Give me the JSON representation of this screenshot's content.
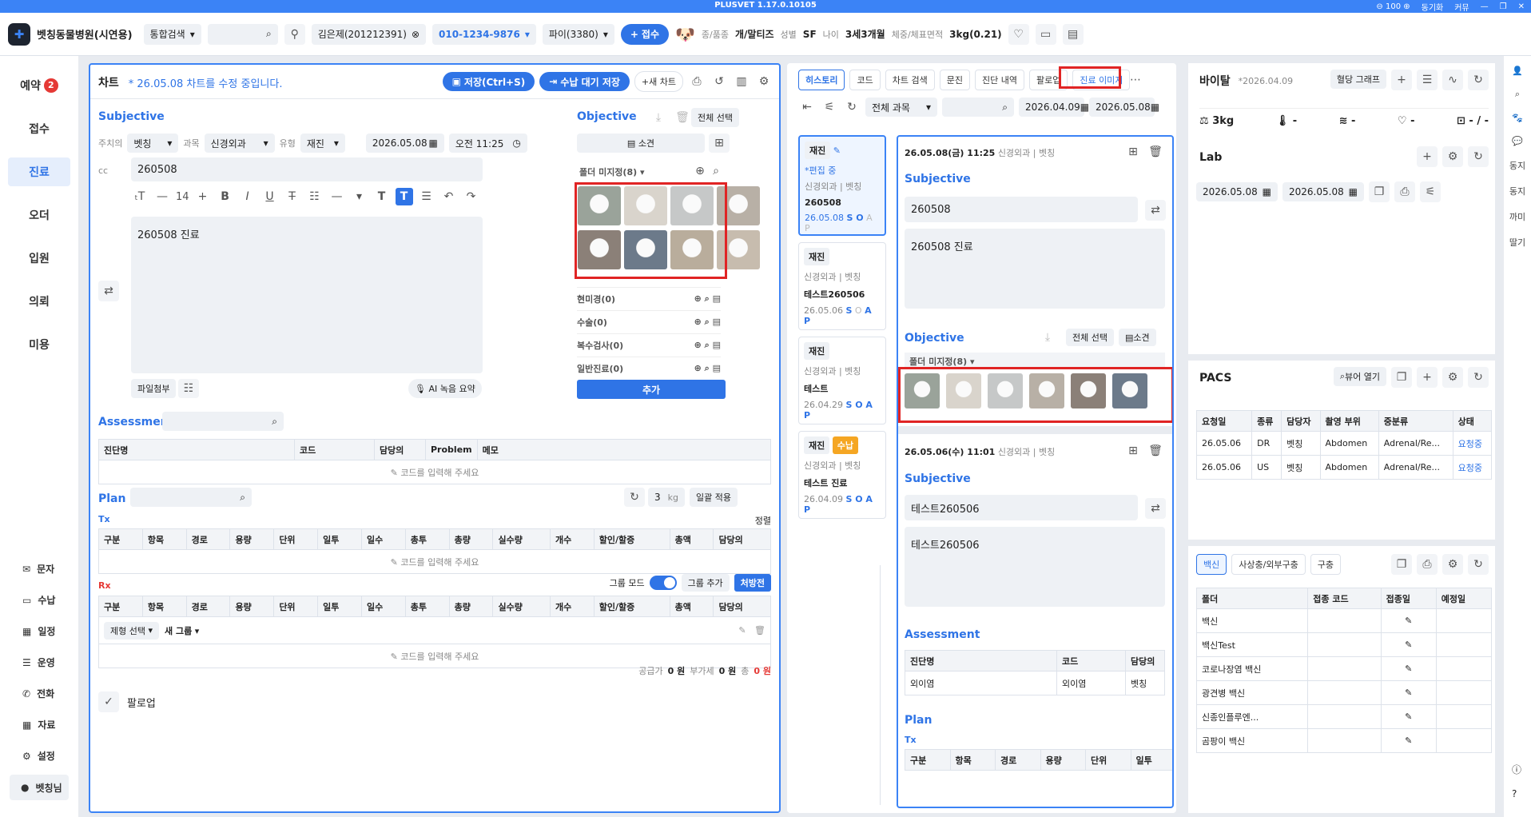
{
  "app": {
    "title": "PLUSVET 1.17.0.10105",
    "zoom": "100",
    "sync": "동기화",
    "mode": "커뮤",
    "phone": "커뮤"
  },
  "header": {
    "hospital": "벳칭동물병원(시연용)",
    "search_type": "통합검색",
    "patient": "김은제(201212391)",
    "phone": "010-1234-9876",
    "pet": "파이(3380)",
    "reception_btn": "접수",
    "species_label": "종/품종",
    "species": "개/말티즈",
    "sex_label": "성별",
    "sex": "SF",
    "age_label": "나이",
    "age": "3세3개월",
    "weight_label": "체중/체표면적",
    "weight": "3kg(0.21)"
  },
  "nav": {
    "items": [
      {
        "label": "예약",
        "badge": "2"
      },
      {
        "label": "접수"
      },
      {
        "label": "진료"
      },
      {
        "label": "오더"
      },
      {
        "label": "입원"
      },
      {
        "label": "의뢰"
      },
      {
        "label": "미용"
      }
    ],
    "bottom": [
      "문자",
      "수납",
      "일정",
      "운영",
      "전화",
      "자료",
      "설정"
    ],
    "user": "벳칭님"
  },
  "chart": {
    "title": "차트",
    "notice": "* 26.05.08 차트를 수정 중입니다.",
    "save": "저장(Ctrl+S)",
    "save_wait": "수납 대기 저장",
    "new_chart": "새 차트",
    "subjective": "Subjective",
    "doctor_label": "주치의",
    "doctor": "벳칭",
    "dept_label": "과목",
    "dept": "신경외과",
    "type_label": "유형",
    "type": "재진",
    "date": "2026.05.08",
    "time": "오전 11:25",
    "cc_label": "cc",
    "cc": "260508",
    "font_size": "14",
    "body": "260508 진료",
    "attach": "파일첨부",
    "ai": "AI 녹음 요약",
    "objective": "Objective",
    "select_all": "전체 선택",
    "finding": "소견",
    "folder": "폴더 미지정(8)",
    "groups": [
      "현미경(0)",
      "수술(0)",
      "복수검사(0)",
      "일반진료(0)"
    ],
    "add": "추가",
    "assessment": "Assessment",
    "a_cols": [
      "진단명",
      "코드",
      "담당의",
      "Problem",
      "메모"
    ],
    "enter_code": "코드를 입력해 주세요",
    "plan": "Plan",
    "kg_val": "3",
    "kg": "kg",
    "bulk": "일괄 적용",
    "tx": "Tx",
    "sort": "정렬",
    "tx_cols": [
      "구분",
      "항목",
      "경로",
      "용량",
      "단위",
      "일투",
      "일수",
      "총투",
      "총량",
      "실수량",
      "개수",
      "할인/할증",
      "총액",
      "담당의"
    ],
    "rx": "Rx",
    "group_mode": "그룹 모드",
    "add_group": "그룹 추가",
    "prescription": "처방전",
    "form_select": "제형 선택",
    "new_group": "새 그룹",
    "supply": "공급가",
    "supply_val": "0 원",
    "vat": "부가세",
    "vat_val": "0 원",
    "total": "총",
    "total_val": "0 원",
    "followup": "팔로업"
  },
  "history": {
    "tabs": [
      "히스토리",
      "코드",
      "차트 검색",
      "문진",
      "진단 내역",
      "팔로업",
      "진료 이미지"
    ],
    "all_dept": "전체 과목",
    "from": "2026.04.09",
    "to": "2026.05.08",
    "cards": [
      {
        "tag": "재진",
        "editing": "*편집 중",
        "dept": "신경외과 | 벳칭",
        "name": "260508",
        "date": "26.05.08"
      },
      {
        "tag": "재진",
        "dept": "신경외과 | 벳칭",
        "name": "테스트260506",
        "date": "26.05.06"
      },
      {
        "tag": "재진",
        "dept": "신경외과 | 벳칭",
        "name": "테스트",
        "date": "26.04.29"
      },
      {
        "tag": "재진",
        "tag2": "수납",
        "dept": "신경외과 | 벳칭",
        "name": "테스트 진료",
        "date": "26.04.09"
      }
    ],
    "d1": {
      "date": "26.05.08(금) 11:25",
      "dept": "신경외과 | 벳칭",
      "cc": "260508",
      "body": "260508 진료",
      "folder": "폴더 미지정(8)"
    },
    "d2": {
      "date": "26.05.06(수) 11:01",
      "dept": "신경외과 | 벳칭",
      "cc": "테스트260506",
      "body": "테스트260506",
      "a_cols": [
        "진단명",
        "코드",
        "담당의"
      ],
      "a_row": [
        "외이염",
        "외이염",
        "벳칭"
      ],
      "tx_cols": [
        "구분",
        "항목",
        "경로",
        "용량",
        "단위",
        "일투"
      ]
    }
  },
  "vital": {
    "title": "바이탈",
    "date": "*2026.04.09",
    "graph": "혈당 그래프",
    "weight": "3kg",
    "dash": "-",
    "bp": "- / -"
  },
  "lab": {
    "title": "Lab",
    "from": "2026.05.08",
    "to": "2026.05.08"
  },
  "pacs": {
    "title": "PACS",
    "viewer": "뷰어 열기",
    "cols": [
      "요청일",
      "종류",
      "담당자",
      "촬영 부위",
      "중분류",
      "상태"
    ],
    "rows": [
      [
        "26.05.06",
        "DR",
        "벳칭",
        "Abdomen",
        "Adrenal/Re...",
        "요청중"
      ],
      [
        "26.05.06",
        "US",
        "벳칭",
        "Abdomen",
        "Adrenal/Re...",
        "요청중"
      ]
    ]
  },
  "vaccine": {
    "tabs": [
      "백신",
      "사상충/외부구충",
      "구충"
    ],
    "cols": [
      "폴더",
      "접종 코드",
      "접종일",
      "예정일"
    ],
    "rows": [
      "백신",
      "백신Test",
      "코로나장염 백신",
      "광견병 백신",
      "신종인플루엔...",
      "곰팡이 백신"
    ]
  },
  "rside": [
    "동지",
    "동지",
    "까미",
    "딸기"
  ]
}
